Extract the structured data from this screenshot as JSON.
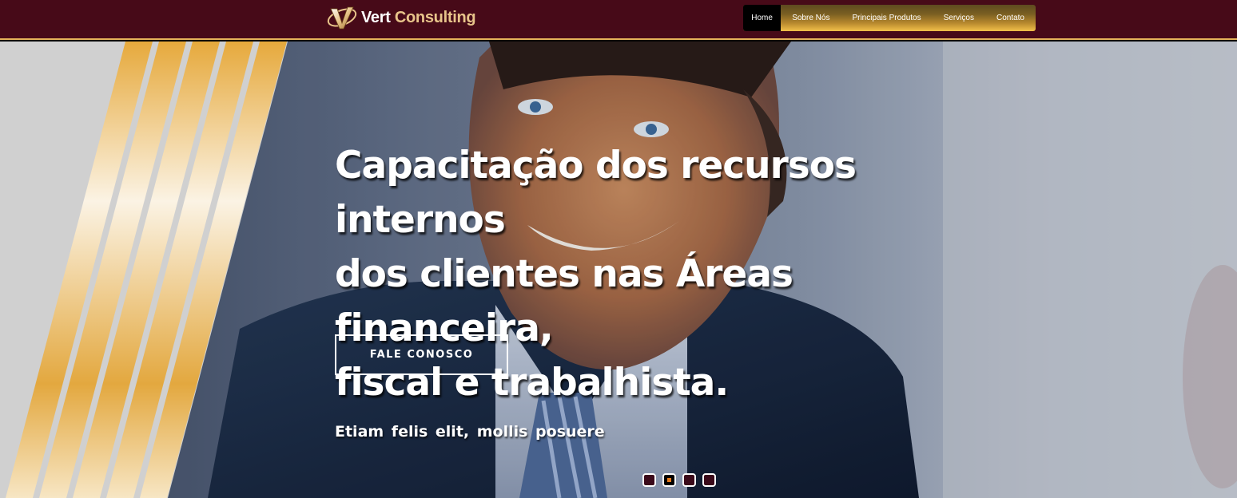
{
  "header": {
    "logo": {
      "word1": "Vert",
      "word2": "Consulting",
      "mark_icon": "v-logo-mark"
    },
    "nav": [
      {
        "label": "Home",
        "active": true
      },
      {
        "label": "Sobre Nós",
        "active": false
      },
      {
        "label": "Principais Produtos",
        "active": false
      },
      {
        "label": "Serviços",
        "active": false
      },
      {
        "label": "Contato",
        "active": false
      }
    ]
  },
  "hero": {
    "title_lines": [
      "Capacitação dos recursos internos",
      "dos clientes nas Áreas financeira,",
      "fiscal e trabalhista."
    ],
    "subtitle": "Etiam felis elit, mollis posuere",
    "button_label": "FALE CONOSCO",
    "slides": {
      "count": 4,
      "active_index": 1
    }
  },
  "colors": {
    "header_bg": "#470a18",
    "gold": "#e5b25a",
    "nav_active_bg": "#000000",
    "dot_active_fill": "#e87a1a"
  }
}
